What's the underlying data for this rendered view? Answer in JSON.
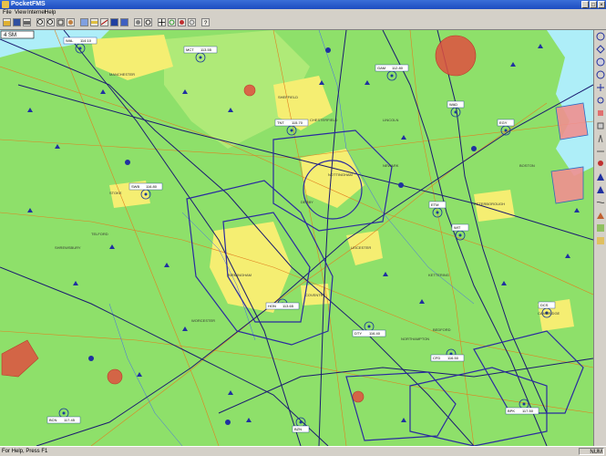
{
  "window": {
    "title": "PocketFMS"
  },
  "menu": [
    "File",
    "View",
    "Internet",
    "Help"
  ],
  "toolbar": [
    "zoom-in",
    "zoom-out",
    "fit",
    "pan",
    "grid",
    "measure",
    "route",
    "airspace",
    "weather",
    "settings",
    "info"
  ],
  "map": {
    "scale_box": "4 SM",
    "navaids": [
      {
        "id": "WAL",
        "freq": "114.10"
      },
      {
        "id": "MCT",
        "freq": "113.55"
      },
      {
        "id": "GAM",
        "freq": "112.80"
      },
      {
        "id": "TNT",
        "freq": "115.70"
      },
      {
        "id": "SWB",
        "freq": "116.80"
      },
      {
        "id": "WAD",
        "freq": ""
      },
      {
        "id": "EGY",
        "freq": ""
      },
      {
        "id": "ETM",
        "freq": ""
      },
      {
        "id": "WIT",
        "freq": ""
      },
      {
        "id": "HON",
        "freq": "113.65"
      },
      {
        "id": "DTY",
        "freq": "116.40"
      },
      {
        "id": "CFD",
        "freq": "116.50"
      },
      {
        "id": "BZN",
        "freq": ""
      },
      {
        "id": "BPK",
        "freq": "117.50"
      },
      {
        "id": "BCN",
        "freq": "117.45"
      },
      {
        "id": "DCS",
        "freq": ""
      }
    ],
    "places": [
      "MANCHESTER",
      "SHEFFIELD",
      "NOTTINGHAM",
      "DERBY",
      "LEICESTER",
      "STOKE",
      "BIRMINGHAM",
      "COVENTRY",
      "PETERBOROUGH",
      "BEDFORD",
      "CAMBRIDGE",
      "WORCESTER",
      "TELFORD",
      "SHREWSBURY",
      "CHESTERFIELD",
      "LINCOLN",
      "BOSTON",
      "NORTHAMPTON",
      "NEWARK",
      "KETTERING"
    ]
  },
  "status": {
    "help": "For Help, Press F1",
    "right": "NUM"
  }
}
